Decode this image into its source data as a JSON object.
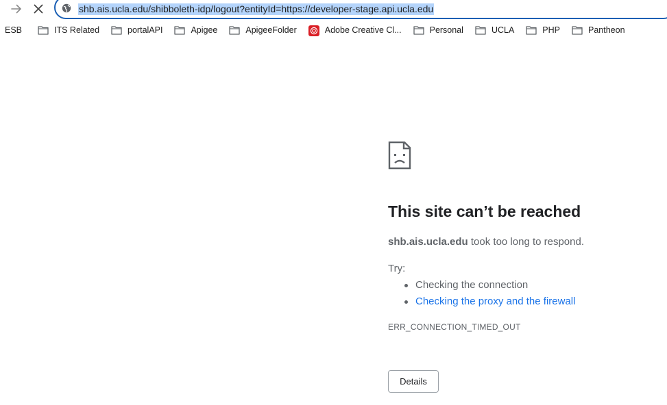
{
  "address_bar": {
    "url": "shb.ais.ucla.edu/shibboleth-idp/logout?entityId=https://developer-stage.api.ucla.edu"
  },
  "bookmarks": [
    {
      "label": "ESB",
      "icon": "none"
    },
    {
      "label": "ITS Related",
      "icon": "folder-icon"
    },
    {
      "label": "portalAPI",
      "icon": "folder-icon"
    },
    {
      "label": "Apigee",
      "icon": "folder-icon"
    },
    {
      "label": "ApigeeFolder",
      "icon": "folder-icon"
    },
    {
      "label": "Adobe Creative Cl...",
      "icon": "adobe-creative-cloud-icon"
    },
    {
      "label": "Personal",
      "icon": "folder-icon"
    },
    {
      "label": "UCLA",
      "icon": "folder-icon"
    },
    {
      "label": "PHP",
      "icon": "folder-icon"
    },
    {
      "label": "Pantheon",
      "icon": "folder-icon"
    }
  ],
  "error": {
    "title": "This site can’t be reached",
    "host": "shb.ais.ucla.edu",
    "message_suffix": " took too long to respond.",
    "try_label": "Try:",
    "suggestions": [
      {
        "text": "Checking the connection",
        "is_link": false
      },
      {
        "text": "Checking the proxy and the firewall",
        "is_link": true
      }
    ],
    "code": "ERR_CONNECTION_TIMED_OUT",
    "details_button": "Details"
  },
  "colors": {
    "link": "#1a73e8",
    "omnibox_border": "#1a5fb4",
    "selection": "#b4d4fb"
  }
}
